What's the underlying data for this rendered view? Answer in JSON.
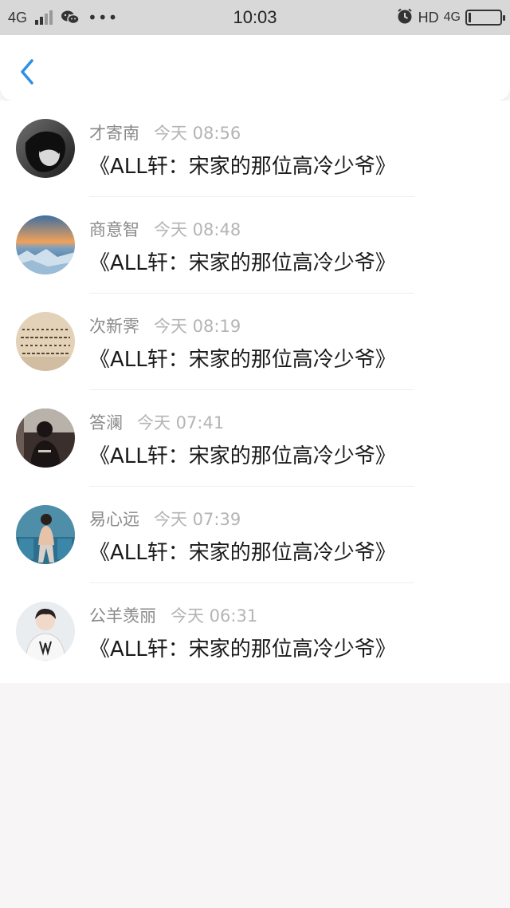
{
  "status_bar": {
    "network": "4G",
    "time": "10:03",
    "hd": "HD",
    "network_right": "4G",
    "icons": [
      "signal-icon",
      "wechat-icon",
      "more-dots-icon",
      "alarm-icon",
      "battery-icon"
    ]
  },
  "nav": {
    "back_icon": "chevron-left-icon"
  },
  "messages": [
    {
      "name": "才寄南",
      "time": "今天 08:56",
      "title": "《ALL轩：宋家的那位高冷少爷》"
    },
    {
      "name": "商意智",
      "time": "今天 08:48",
      "title": "《ALL轩：宋家的那位高冷少爷》"
    },
    {
      "name": "次新霁",
      "time": "今天 08:19",
      "title": "《ALL轩：宋家的那位高冷少爷》"
    },
    {
      "name": "答澜",
      "time": "今天 07:41",
      "title": "《ALL轩：宋家的那位高冷少爷》"
    },
    {
      "name": "易心远",
      "time": "今天 07:39",
      "title": "《ALL轩：宋家的那位高冷少爷》"
    },
    {
      "name": "公羊羡丽",
      "time": "今天 06:31",
      "title": "《ALL轩：宋家的那位高冷少爷》"
    }
  ],
  "colors": {
    "accent": "#2f8fe6",
    "background": "#f7f5f5"
  }
}
